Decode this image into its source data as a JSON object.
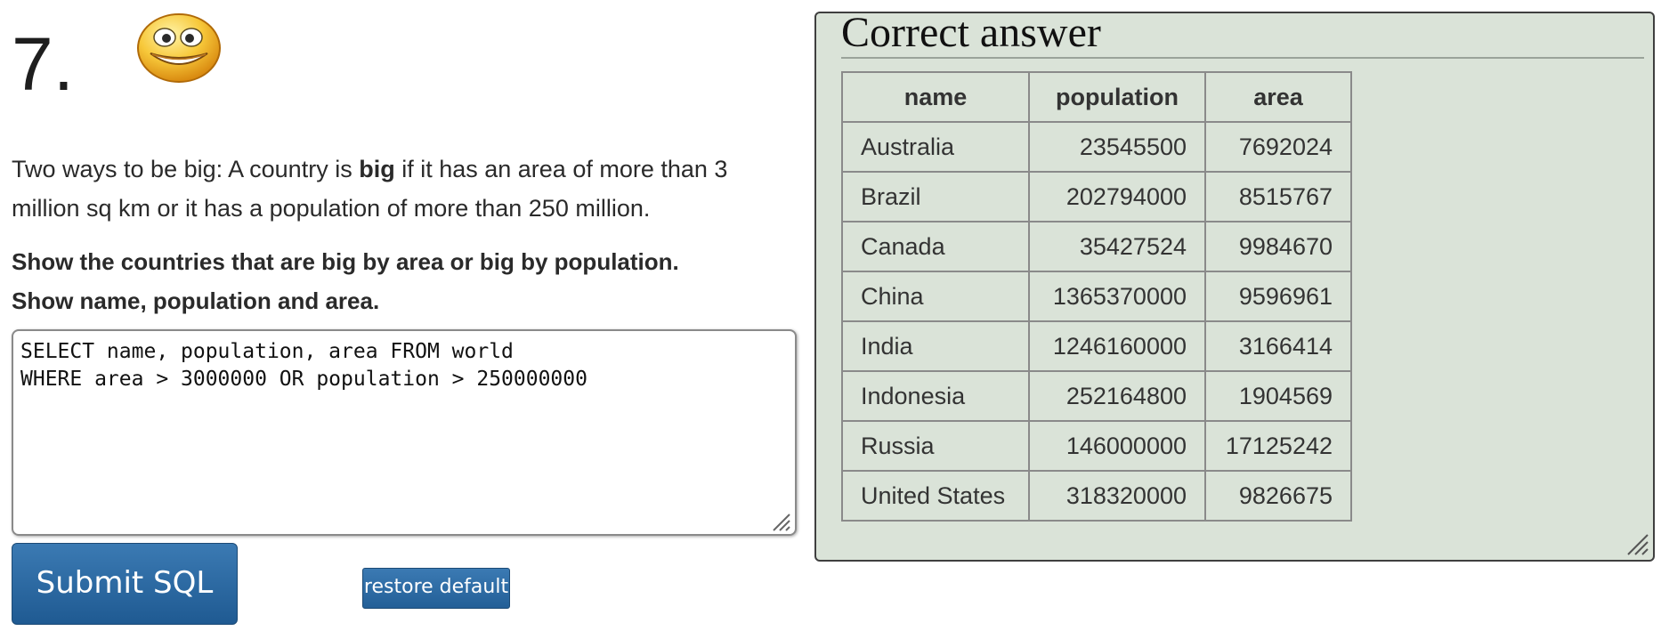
{
  "question": {
    "number": "7.",
    "intro": {
      "part1": "Two ways to be big: A country is ",
      "bold": "big",
      "part2": " if it has an area of more than 3 million sq km or it has a population of more than 250 million."
    },
    "task_line1": "Show the countries that are big by area or big by population.",
    "task_line2": "Show name, population and area."
  },
  "editor": {
    "sql": "SELECT name, population, area FROM world\nWHERE area > 3000000 OR population > 250000000"
  },
  "buttons": {
    "submit_label": "Submit SQL",
    "restore_label": "restore default"
  },
  "answer_panel": {
    "title": "Correct answer",
    "columns": [
      "name",
      "population",
      "area"
    ],
    "rows": [
      [
        "Australia",
        "23545500",
        "7692024"
      ],
      [
        "Brazil",
        "202794000",
        "8515767"
      ],
      [
        "Canada",
        "35427524",
        "9984670"
      ],
      [
        "China",
        "1365370000",
        "9596961"
      ],
      [
        "India",
        "1246160000",
        "3166414"
      ],
      [
        "Indonesia",
        "252164800",
        "1904569"
      ],
      [
        "Russia",
        "146000000",
        "17125242"
      ],
      [
        "United States",
        "318320000",
        "9826675"
      ]
    ]
  },
  "icons": {
    "smiley": "smiley-face-icon",
    "editor_grip": "resize-grip-icon",
    "panel_grip": "resize-grip-icon"
  },
  "colors": {
    "panel_bg": "#dae3d8",
    "button_blue": "#2a6aa3"
  }
}
